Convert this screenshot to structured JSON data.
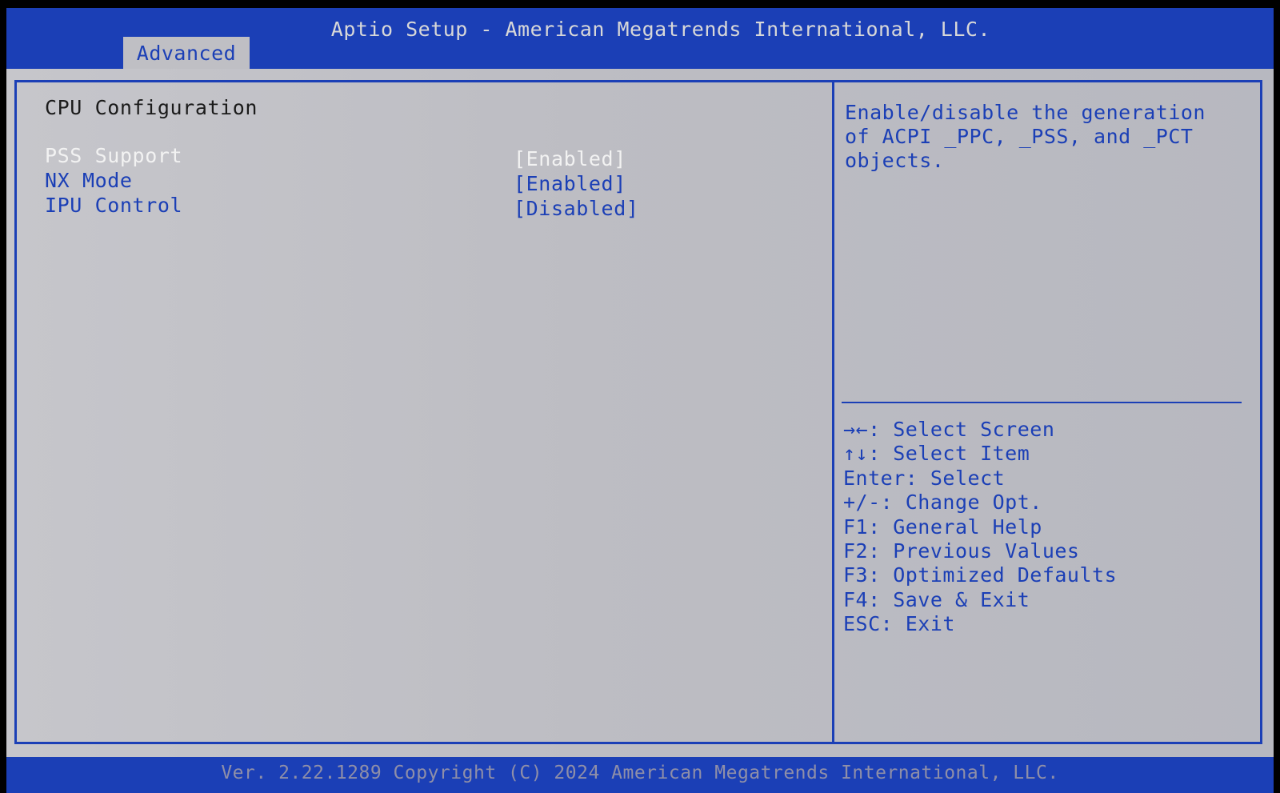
{
  "header": {
    "title": "Aptio Setup - American Megatrends International, LLC.",
    "tab_label": "Advanced"
  },
  "main": {
    "section_title": "CPU Configuration",
    "settings": [
      {
        "label": "PSS Support",
        "value": "[Enabled]"
      },
      {
        "label": "NX Mode",
        "value": "[Enabled]"
      },
      {
        "label": "IPU Control",
        "value": "[Disabled]"
      }
    ]
  },
  "help": {
    "text": "Enable/disable the generation\nof ACPI _PPC, _PSS, and _PCT\nobjects."
  },
  "keys": [
    "→←: Select Screen",
    "↑↓: Select Item",
    "Enter: Select",
    "+/-: Change Opt.",
    "F1: General Help",
    "F2: Previous Values",
    "F3: Optimized Defaults",
    "F4: Save & Exit",
    "ESC: Exit"
  ],
  "footer": {
    "text": "Ver. 2.22.1289 Copyright (C) 2024 American Megatrends International, LLC."
  },
  "colors": {
    "bios_blue": "#1b3fb6",
    "panel_gray": "#c0c0c6",
    "selected_text": "#f2f2f2"
  }
}
